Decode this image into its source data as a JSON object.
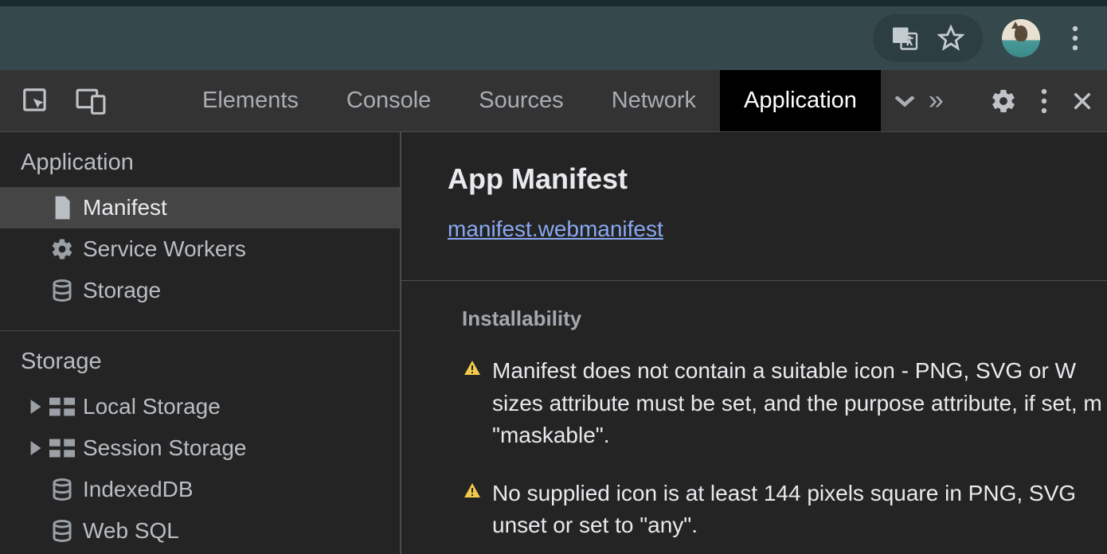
{
  "toolbar": {
    "tabs": [
      "Elements",
      "Console",
      "Sources",
      "Network",
      "Application"
    ],
    "active_tab": "Application"
  },
  "sidebar": {
    "sections": [
      {
        "title": "Application",
        "items": [
          {
            "label": "Manifest",
            "icon": "file",
            "selected": true
          },
          {
            "label": "Service Workers",
            "icon": "gear"
          },
          {
            "label": "Storage",
            "icon": "db"
          }
        ]
      },
      {
        "title": "Storage",
        "items": [
          {
            "label": "Local Storage",
            "icon": "table",
            "expandable": true
          },
          {
            "label": "Session Storage",
            "icon": "table",
            "expandable": true
          },
          {
            "label": "IndexedDB",
            "icon": "db"
          },
          {
            "label": "Web SQL",
            "icon": "db"
          }
        ]
      }
    ]
  },
  "content": {
    "title": "App Manifest",
    "manifest_link": "manifest.webmanifest",
    "installability_heading": "Installability",
    "warnings": [
      "Manifest does not contain a suitable icon - PNG, SVG or W sizes attribute must be set, and the purpose attribute, if set, m \"maskable\".",
      "No supplied icon is at least 144 pixels square in PNG, SVG unset or set to \"any\"."
    ]
  }
}
